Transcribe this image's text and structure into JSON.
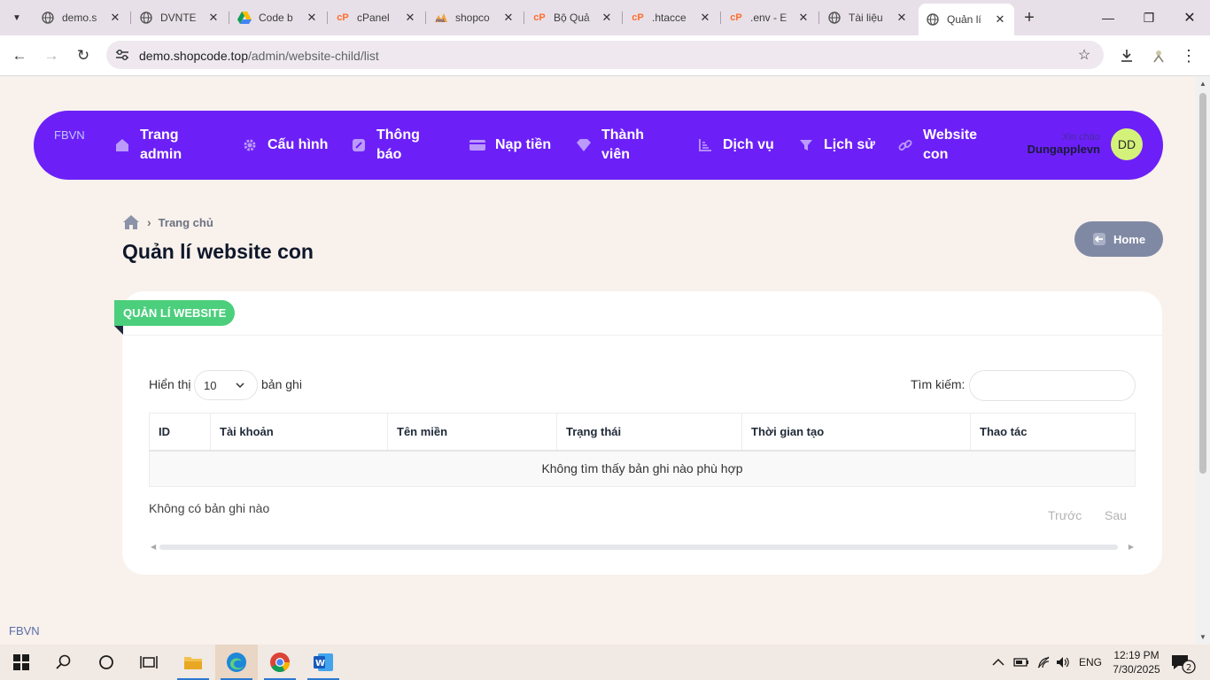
{
  "browser": {
    "tabs": [
      {
        "label": "demo.s",
        "favicon": "globe-icon",
        "active": false
      },
      {
        "label": "DVNTE",
        "favicon": "globe-icon",
        "active": false
      },
      {
        "label": "Code b",
        "favicon": "google-drive-icon",
        "active": false
      },
      {
        "label": "cPanel",
        "favicon": "cpanel-icon",
        "active": false
      },
      {
        "label": "shopco",
        "favicon": "phpmyadmin-icon",
        "active": false
      },
      {
        "label": "Bộ Quả",
        "favicon": "cpanel-icon",
        "active": false
      },
      {
        "label": ".htacce",
        "favicon": "cpanel-icon",
        "active": false
      },
      {
        "label": ".env - E",
        "favicon": "cpanel-icon",
        "active": false
      },
      {
        "label": "Tài liệu",
        "favicon": "globe-icon",
        "active": false
      },
      {
        "label": "Quản lí",
        "favicon": "globe-icon",
        "active": true
      }
    ],
    "url_host": "demo.shopcode.top",
    "url_path": "/admin/website-child/list"
  },
  "nav": {
    "logo_alt": "FBVN",
    "items": [
      {
        "label": "Trang admin",
        "icon": "home-icon"
      },
      {
        "label": "Cấu hình",
        "icon": "gear-icon"
      },
      {
        "label": "Thông báo",
        "icon": "pencil-icon"
      },
      {
        "label": "Nạp tiền",
        "icon": "credit-card-icon"
      },
      {
        "label": "Thành viên",
        "icon": "diamond-icon"
      },
      {
        "label": "Dịch vụ",
        "icon": "chart-icon"
      },
      {
        "label": "Lịch sử",
        "icon": "filter-icon"
      },
      {
        "label": "Website con",
        "icon": "link-icon"
      }
    ],
    "greeting": "Xin chào",
    "username": "Dungapplevn",
    "avatar_initials": "DD"
  },
  "breadcrumb": {
    "current": "Trang chủ"
  },
  "page_title": "Quản lí website con",
  "home_button": "Home",
  "card": {
    "ribbon": "QUẢN LÍ WEBSITE",
    "length_prefix": "Hiển thị",
    "length_value": "10",
    "length_suffix": "bản ghi",
    "search_label": "Tìm kiếm:",
    "search_value": "",
    "columns": [
      "ID",
      "Tài khoản",
      "Tên miền",
      "Trạng thái",
      "Thời gian tạo",
      "Thao tác"
    ],
    "empty_message": "Không tìm thấy bản ghi nào phù hợp",
    "info": "Không có bản ghi nào",
    "prev": "Trước",
    "next": "Sau"
  },
  "footer_logo_alt": "FBVN",
  "taskbar": {
    "lang": "ENG",
    "time": "12:19 PM",
    "date": "7/30/2025",
    "notifications": "2"
  },
  "colors": {
    "nav_bg": "#6c20f7",
    "ribbon": "#4ccf7c",
    "avatar": "#d4f279",
    "page_bg": "#f8f1ec",
    "home_button": "#8089a4"
  }
}
